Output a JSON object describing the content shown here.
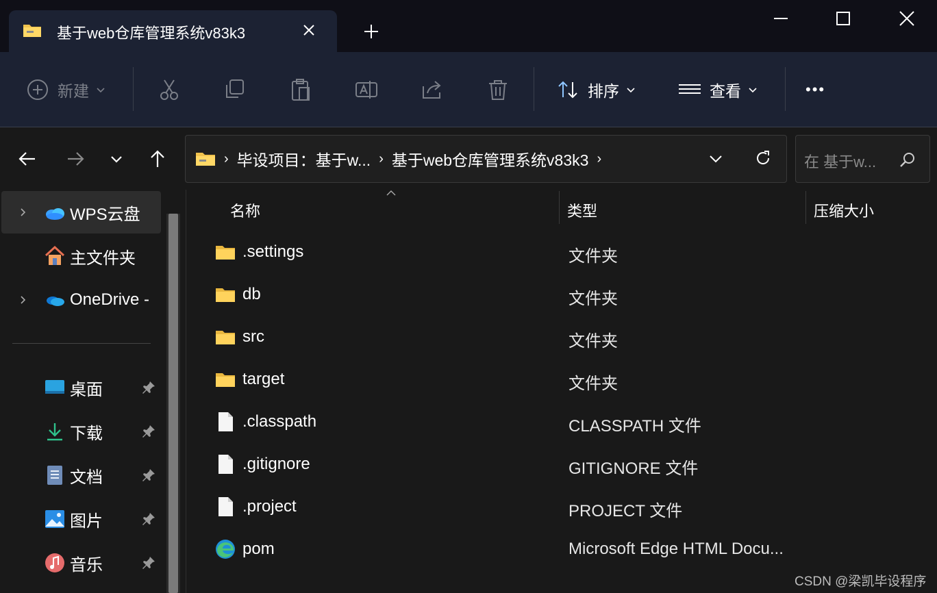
{
  "window": {
    "tab_title": "基于web仓库管理系统v83k3",
    "tab_close": "✕",
    "new_tab": "+",
    "accent": "#1c2233"
  },
  "toolbar": {
    "new_label": "新建",
    "sort_label": "排序",
    "view_label": "查看",
    "more": "•••"
  },
  "address": {
    "crumbs": [
      "毕设项目：基于w...",
      "基于web仓库管理系统v83k3"
    ]
  },
  "search": {
    "placeholder": "在 基于w..."
  },
  "sidebar": {
    "items": [
      {
        "label": "WPS云盘",
        "icon": "wps-cloud-icon"
      },
      {
        "label": "主文件夹",
        "icon": "home-icon"
      },
      {
        "label": "OneDrive -",
        "icon": "onedrive-icon"
      },
      {
        "label": "桌面",
        "icon": "desktop-icon"
      },
      {
        "label": "下载",
        "icon": "download-icon"
      },
      {
        "label": "文档",
        "icon": "documents-icon"
      },
      {
        "label": "图片",
        "icon": "pictures-icon"
      },
      {
        "label": "音乐",
        "icon": "music-icon"
      }
    ]
  },
  "columns": {
    "name": "名称",
    "type": "类型",
    "size": "压缩大小"
  },
  "files": [
    {
      "name": ".settings",
      "type": "文件夹",
      "icon": "folder-icon"
    },
    {
      "name": "db",
      "type": "文件夹",
      "icon": "folder-icon"
    },
    {
      "name": "src",
      "type": "文件夹",
      "icon": "folder-icon"
    },
    {
      "name": "target",
      "type": "文件夹",
      "icon": "folder-icon"
    },
    {
      "name": ".classpath",
      "type": "CLASSPATH 文件",
      "icon": "file-icon"
    },
    {
      "name": ".gitignore",
      "type": "GITIGNORE 文件",
      "icon": "file-icon"
    },
    {
      "name": ".project",
      "type": "PROJECT 文件",
      "icon": "file-icon"
    },
    {
      "name": "pom",
      "type": "Microsoft Edge HTML Docu...",
      "icon": "edge-icon"
    }
  ],
  "watermark": "CSDN @梁凯毕设程序"
}
